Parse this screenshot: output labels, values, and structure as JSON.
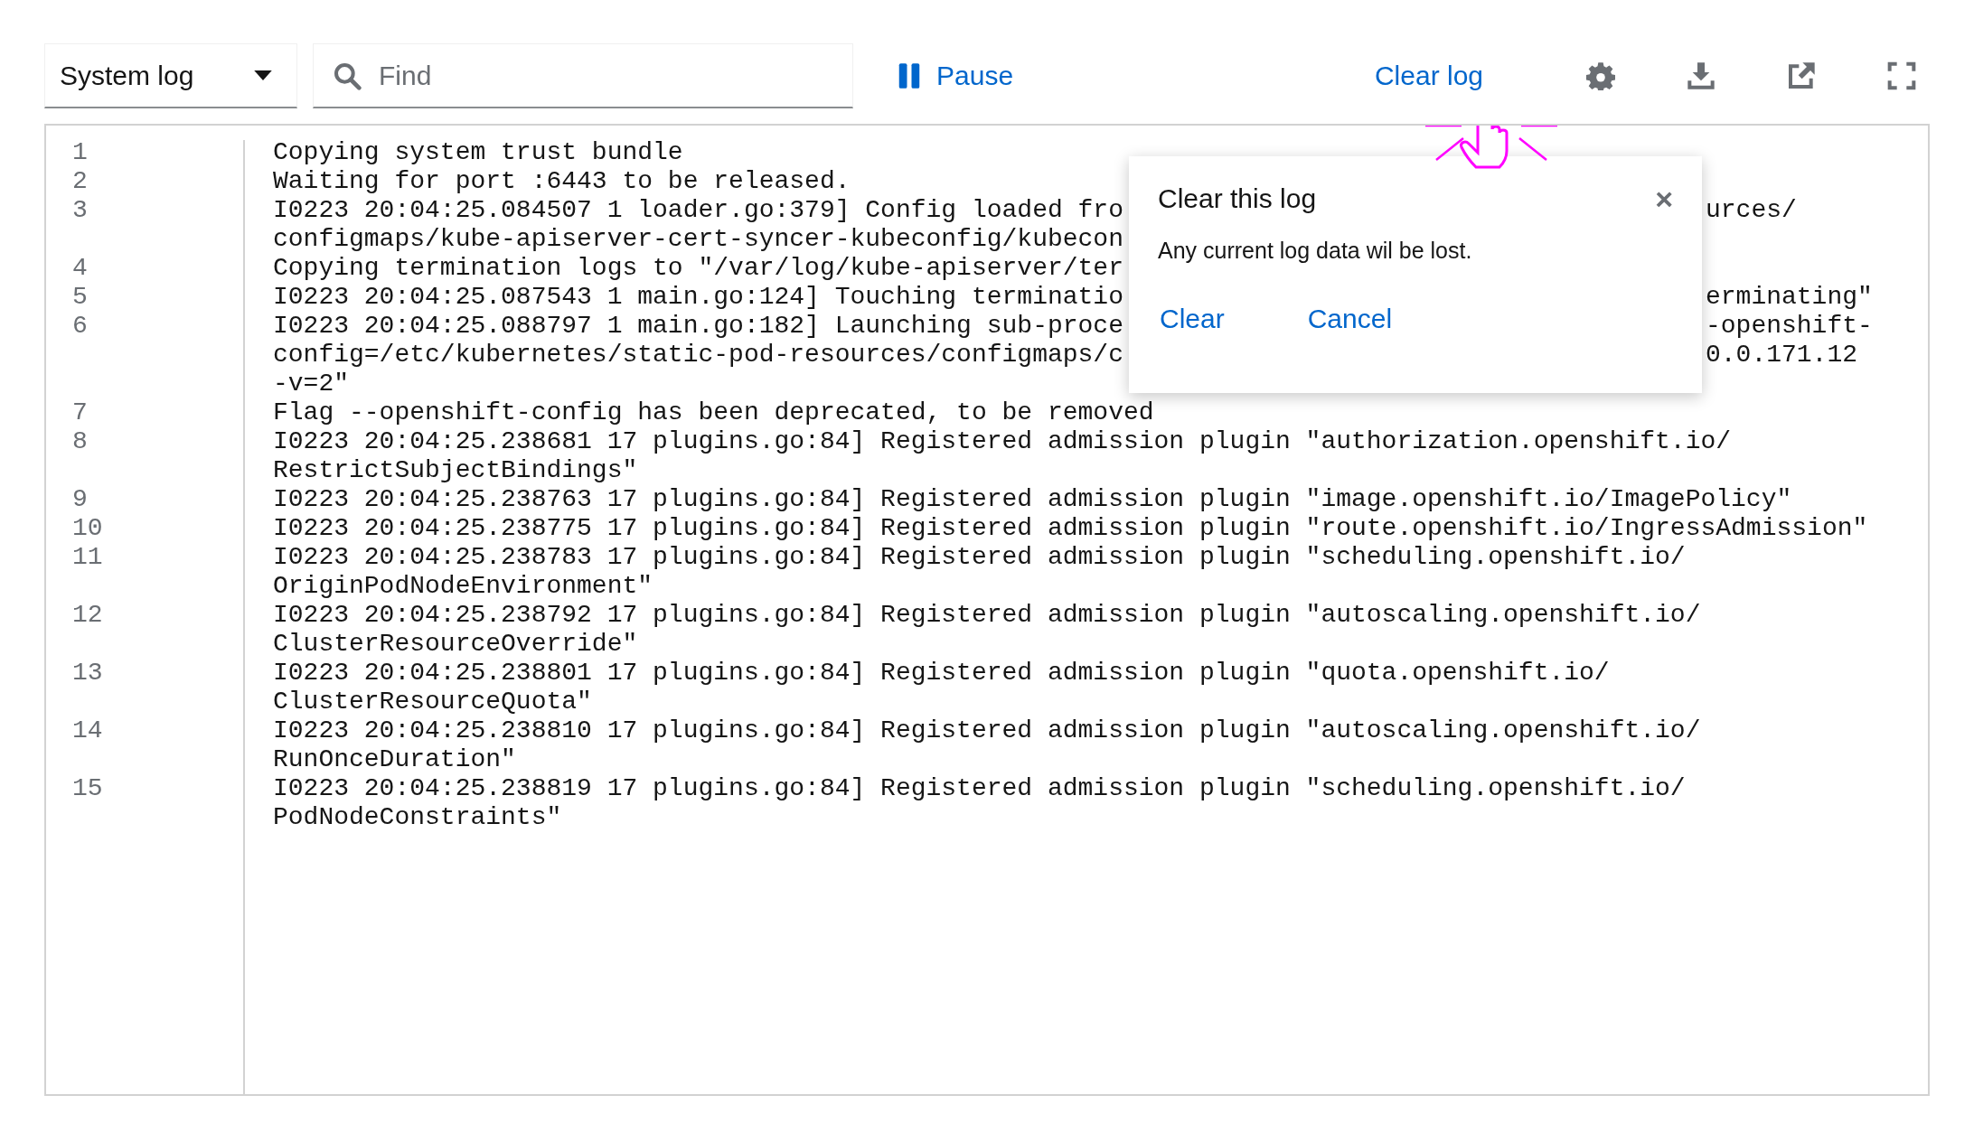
{
  "toolbar": {
    "log_select": {
      "value": "System log"
    },
    "search": {
      "placeholder": "Find"
    },
    "pause": {
      "label": "Pause"
    },
    "clear_log": {
      "label": "Clear log"
    }
  },
  "log": [
    {
      "number": "1",
      "lines": [
        {
          "text": "Copying system trust bundle"
        }
      ]
    },
    {
      "number": "2",
      "lines": [
        {
          "text": "Waiting for port :6443 to be released."
        }
      ]
    },
    {
      "number": "3",
      "lines": [
        {
          "text": "I0223 20:04:25.084507 1 loader.go:379] Config loaded fro",
          "tail": "urces/"
        },
        {
          "text": "configmaps/kube-apiserver-cert-syncer-kubeconfig/kubecon"
        }
      ]
    },
    {
      "number": "4",
      "lines": [
        {
          "text": "Copying termination logs to \"/var/log/kube-apiserver/ter"
        }
      ]
    },
    {
      "number": "5",
      "lines": [
        {
          "text": "I0223 20:04:25.087543 1 main.go:124] Touching terminatio",
          "tail": "erminating\""
        }
      ]
    },
    {
      "number": "6",
      "lines": [
        {
          "text": "I0223 20:04:25.088797 1 main.go:182] Launching sub-proce",
          "tail": "-openshift-"
        },
        {
          "text": "config=/etc/kubernetes/static-pod-resources/configmaps/c",
          "tail": "0.0.171.12"
        },
        {
          "text": "-v=2\""
        }
      ]
    },
    {
      "number": "7",
      "lines": [
        {
          "text": "Flag --openshift-config has been deprecated, to be removed"
        }
      ]
    },
    {
      "number": "8",
      "lines": [
        {
          "text": "I0223 20:04:25.238681 17 plugins.go:84] Registered admission plugin \"authorization.openshift.io/"
        },
        {
          "text": "RestrictSubjectBindings\""
        }
      ]
    },
    {
      "number": "9",
      "lines": [
        {
          "text": "I0223 20:04:25.238763 17 plugins.go:84] Registered admission plugin \"image.openshift.io/ImagePolicy\""
        }
      ]
    },
    {
      "number": "10",
      "lines": [
        {
          "text": "I0223 20:04:25.238775 17 plugins.go:84] Registered admission plugin \"route.openshift.io/IngressAdmission\""
        }
      ]
    },
    {
      "number": "11",
      "lines": [
        {
          "text": "I0223 20:04:25.238783 17 plugins.go:84] Registered admission plugin \"scheduling.openshift.io/"
        },
        {
          "text": "OriginPodNodeEnvironment\""
        }
      ]
    },
    {
      "number": "12",
      "lines": [
        {
          "text": "I0223 20:04:25.238792 17 plugins.go:84] Registered admission plugin \"autoscaling.openshift.io/"
        },
        {
          "text": "ClusterResourceOverride\""
        }
      ]
    },
    {
      "number": "13",
      "lines": [
        {
          "text": "I0223 20:04:25.238801 17 plugins.go:84] Registered admission plugin \"quota.openshift.io/"
        },
        {
          "text": "ClusterResourceQuota\""
        }
      ]
    },
    {
      "number": "14",
      "lines": [
        {
          "text": "I0223 20:04:25.238810 17 plugins.go:84] Registered admission plugin \"autoscaling.openshift.io/"
        },
        {
          "text": "RunOnceDuration\""
        }
      ]
    },
    {
      "number": "15",
      "lines": [
        {
          "text": "I0223 20:04:25.238819 17 plugins.go:84] Registered admission plugin \"scheduling.openshift.io/"
        },
        {
          "text": "PodNodeConstraints\""
        }
      ]
    }
  ],
  "popover": {
    "title": "Clear this log",
    "close": "×",
    "body": "Any current log data wil be lost.",
    "actions": [
      {
        "label": "Clear"
      },
      {
        "label": "Cancel"
      }
    ]
  }
}
